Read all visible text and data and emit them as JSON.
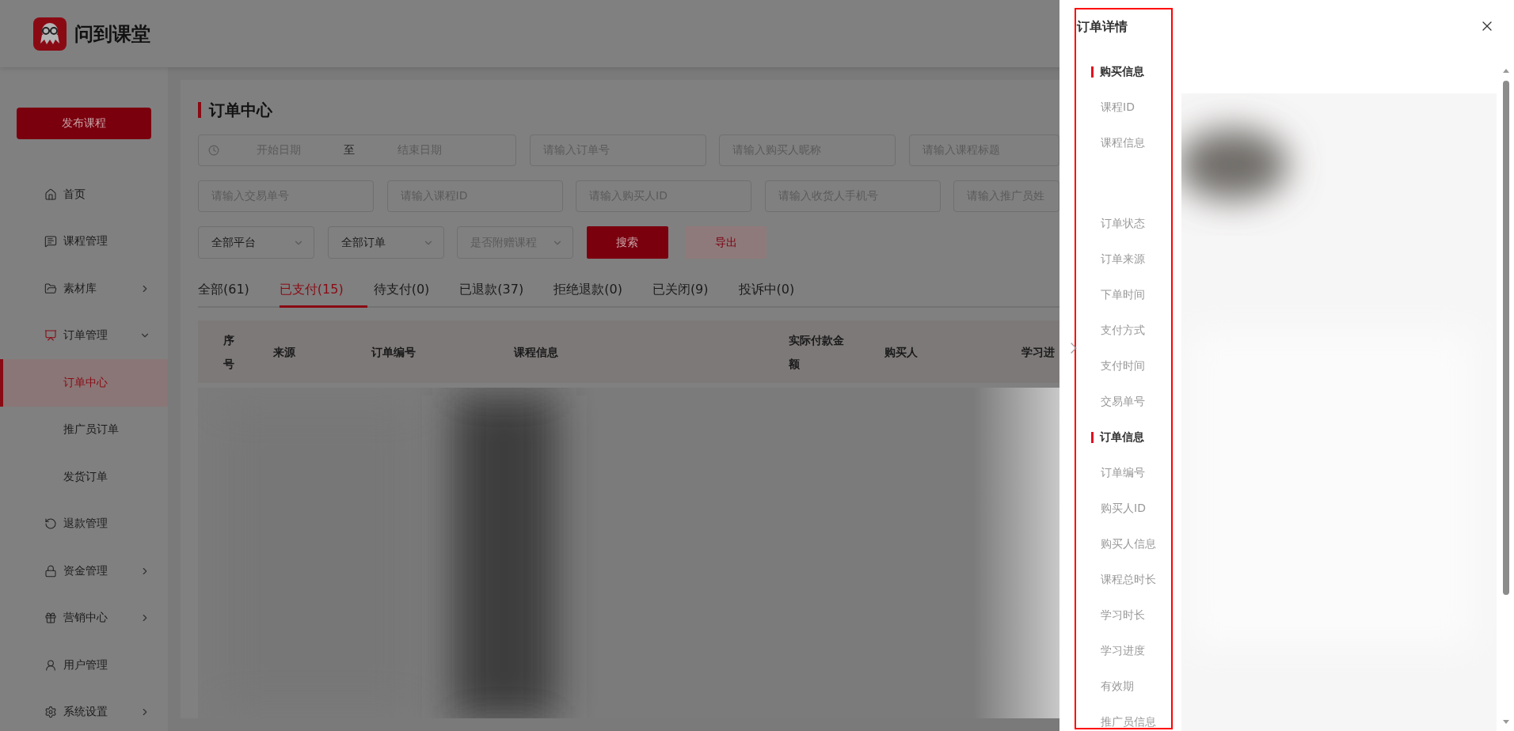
{
  "app": {
    "name": "问到课堂"
  },
  "sidebar": {
    "publish_button": "发布课程",
    "items": [
      {
        "label": "首页",
        "selected": false
      },
      {
        "label": "课程管理",
        "selected": false
      },
      {
        "label": "素材库",
        "selected": false,
        "expanded": false
      },
      {
        "label": "订单管理",
        "selected": false,
        "expanded": true,
        "children": [
          {
            "label": "订单中心",
            "selected": true
          },
          {
            "label": "推广员订单",
            "selected": false
          },
          {
            "label": "发货订单",
            "selected": false
          }
        ]
      },
      {
        "label": "退款管理",
        "selected": false
      },
      {
        "label": "资金管理",
        "selected": false,
        "expanded": false
      },
      {
        "label": "营销中心",
        "selected": false,
        "expanded": false
      },
      {
        "label": "用户管理",
        "selected": false
      },
      {
        "label": "系统设置",
        "selected": false,
        "expanded": false
      }
    ]
  },
  "page": {
    "title": "订单中心",
    "date_range": {
      "start_placeholder": "开始日期",
      "separator": "至",
      "end_placeholder": "结束日期"
    },
    "filters_row_1": [
      {
        "placeholder": "请输入订单号"
      },
      {
        "placeholder": "请输入购买人昵称"
      },
      {
        "placeholder": "请输入课程标题"
      }
    ],
    "filters_row_2": [
      {
        "placeholder": "请输入交易单号"
      },
      {
        "placeholder": "请输入课程ID"
      },
      {
        "placeholder": "请输入购买人ID"
      },
      {
        "placeholder": "请输入收货人手机号"
      },
      {
        "placeholder": "请输入推广员姓"
      }
    ],
    "selects": [
      {
        "value": "全部平台"
      },
      {
        "value": "全部订单"
      },
      {
        "placeholder": "是否附赠课程"
      }
    ],
    "buttons": [
      {
        "label": "搜索",
        "kind": "primary"
      },
      {
        "label": "导出",
        "kind": "secondary"
      }
    ],
    "tabs": [
      {
        "label": "全部(61)",
        "selected": false
      },
      {
        "label": "已支付(15)",
        "selected": true
      },
      {
        "label": "待支付(0)",
        "selected": false
      },
      {
        "label": "已退款(37)",
        "selected": false
      },
      {
        "label": "拒绝退款(0)",
        "selected": false
      },
      {
        "label": "已关闭(9)",
        "selected": false
      },
      {
        "label": "投诉中(0)",
        "selected": false
      }
    ],
    "table": {
      "columns": [
        "序号",
        "来源",
        "订单编号",
        "课程信息",
        "实际付款金额",
        "购买人",
        "学习进"
      ]
    }
  },
  "drawer": {
    "title": "订单详情",
    "sections": [
      {
        "title": "购买信息",
        "fields": [
          {
            "label": "课程ID",
            "kind": "text"
          },
          {
            "label": "课程信息",
            "kind": "image"
          },
          {
            "label": "订单状态",
            "kind": "text"
          },
          {
            "label": "订单来源",
            "kind": "text"
          },
          {
            "label": "下单时间",
            "kind": "text"
          },
          {
            "label": "支付方式",
            "kind": "text"
          },
          {
            "label": "支付时间",
            "kind": "text"
          },
          {
            "label": "交易单号",
            "kind": "text"
          }
        ]
      },
      {
        "title": "订单信息",
        "fields": [
          {
            "label": "订单编号",
            "kind": "text"
          },
          {
            "label": "购买人ID",
            "kind": "text"
          },
          {
            "label": "购买人信息",
            "kind": "text"
          },
          {
            "label": "课程总时长",
            "kind": "text"
          },
          {
            "label": "学习时长",
            "kind": "text"
          },
          {
            "label": "学习进度",
            "kind": "text"
          },
          {
            "label": "有效期",
            "kind": "text"
          },
          {
            "label": "推广员信息",
            "kind": "text"
          }
        ]
      }
    ]
  }
}
